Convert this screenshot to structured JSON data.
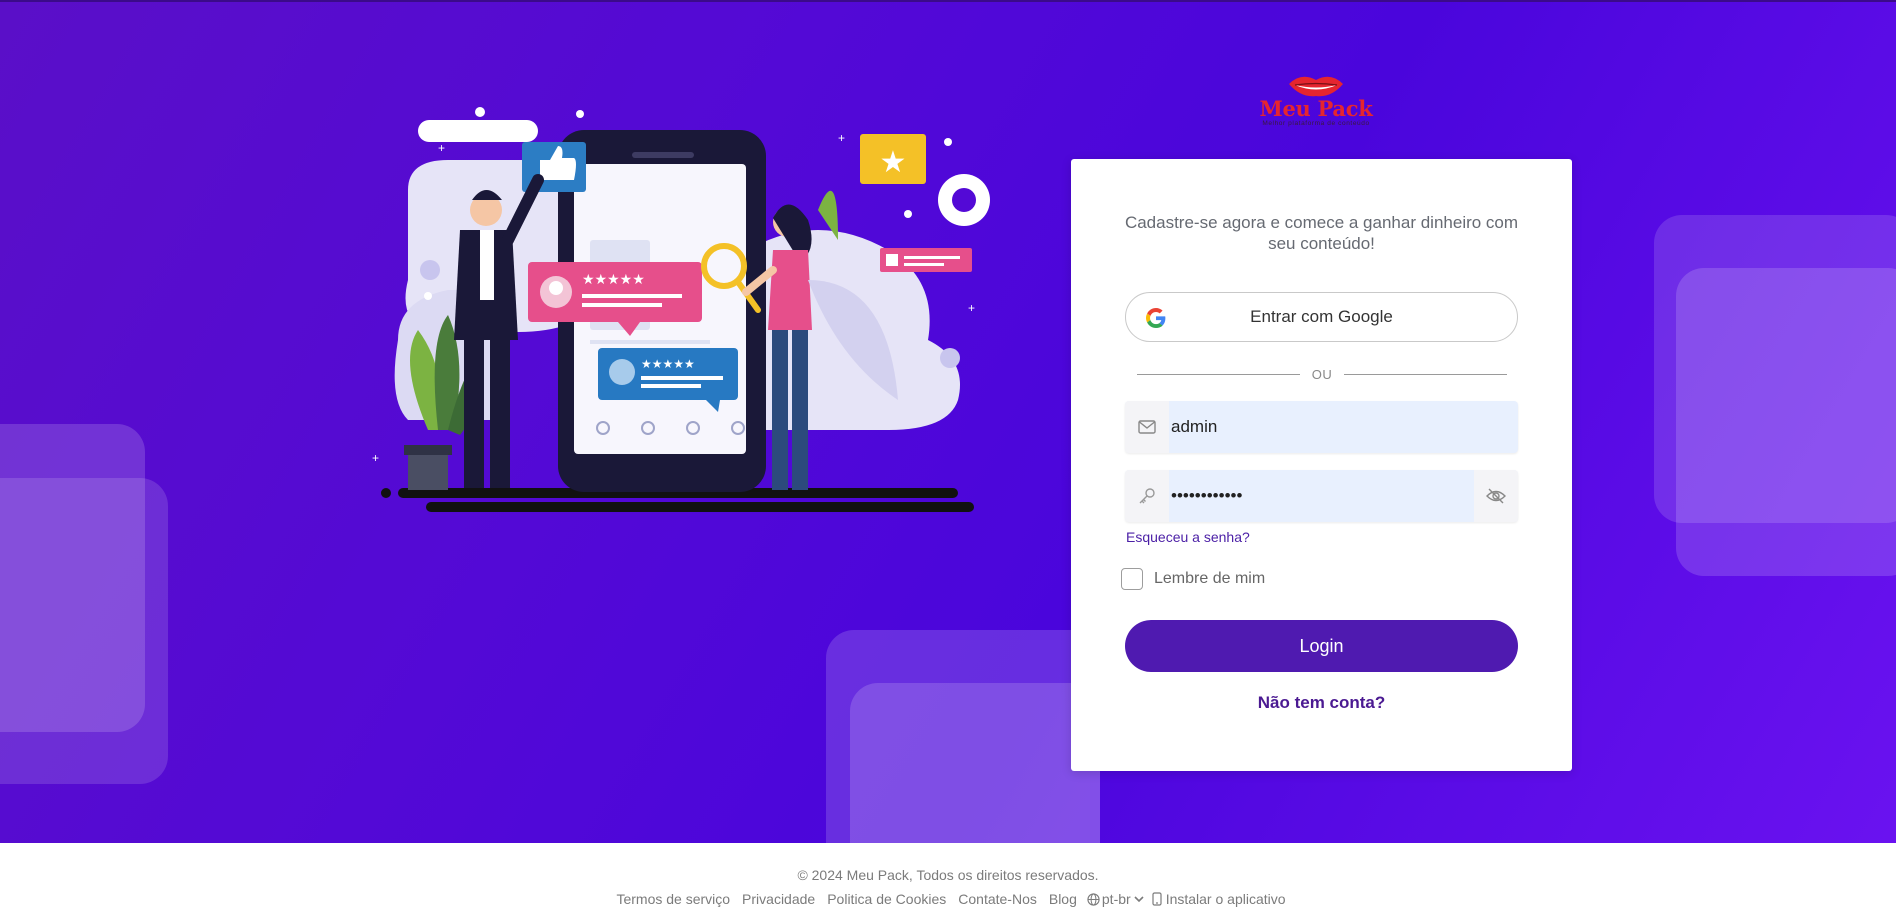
{
  "brand": {
    "name": "Meu Pack",
    "tagline": "Melhor plataforma de conteúdo"
  },
  "card": {
    "lead": "Cadastre-se agora e comece a ganhar dinheiro com seu conteúdo!",
    "google_label": "Entrar com Google",
    "or_label": "OU",
    "email": {
      "value": "admin",
      "icon": "envelope-icon"
    },
    "password": {
      "value": "••••••••••••",
      "icon": "key-icon",
      "toggle_icon": "eye-off-icon"
    },
    "forgot_label": "Esqueceu a senha?",
    "remember_label": "Lembre de mim",
    "login_label": "Login",
    "signup_label": "Não tem conta?"
  },
  "footer": {
    "copyright": "© 2024 Meu Pack, Todos os direitos reservados.",
    "links": [
      "Termos de serviço",
      "Privacidade",
      "Politica de Cookies",
      "Contate-Nos",
      "Blog"
    ],
    "language": "pt-br",
    "install_label": "Instalar o aplicativo"
  },
  "colors": {
    "hero_bg": "#5309d6",
    "primary": "#4f1ab0",
    "brand_red": "#e5252f",
    "input_bg": "#e8f0fe"
  }
}
